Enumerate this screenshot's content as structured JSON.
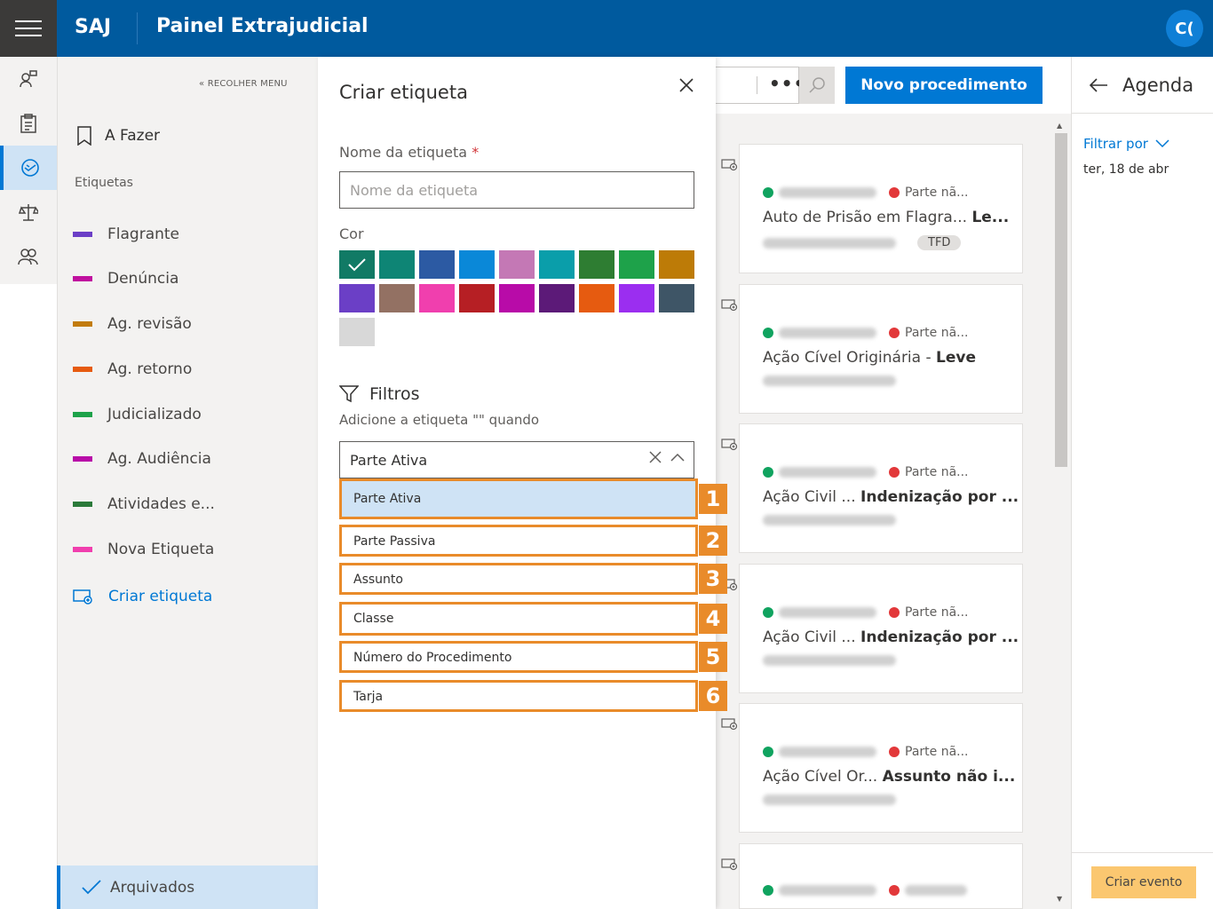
{
  "app": {
    "brand": "SAJ",
    "title": "Painel Extrajudicial",
    "avatar": "C("
  },
  "sidebar": {
    "collapse_label": "RECOLHER MENU",
    "afazer": "A Fazer",
    "etiquetas_heading": "Etiquetas",
    "tags": [
      {
        "label": "Flagrante",
        "color": "#6b3fc6"
      },
      {
        "label": "Denúncia",
        "color": "#c0109f"
      },
      {
        "label": "Ag. revisão",
        "color": "#c27c0e"
      },
      {
        "label": "Ag. retorno",
        "color": "#e65b10"
      },
      {
        "label": "Judicializado",
        "color": "#1ea24a"
      },
      {
        "label": "Ag. Audiência",
        "color": "#b80ba8"
      },
      {
        "label": "Atividades e...",
        "color": "#2b7a3a"
      },
      {
        "label": "Nova Etiqueta",
        "color": "#f03fae"
      }
    ],
    "criar_etiqueta": "Criar etiqueta",
    "arquivados": "Arquivados"
  },
  "panel": {
    "title": "Criar etiqueta",
    "name_label": "Nome da etiqueta",
    "required_mark": "*",
    "name_placeholder": "Nome da etiqueta",
    "color_label": "Cor",
    "colors": [
      "#117a65",
      "#0e8575",
      "#2c5aa3",
      "#0a88d8",
      "#c478b5",
      "#0a9eaa",
      "#2e7d32",
      "#1ea24a",
      "#bd7b07",
      "#6b3fc6",
      "#937163",
      "#f03fae",
      "#b61f24",
      "#b80ba8",
      "#5c1a78",
      "#e65b10",
      "#9b2ef0",
      "#3e5566",
      "#d8d8d8"
    ],
    "selected_color_index": 0,
    "filters_title": "Filtros",
    "filters_sub": "Adicione a etiqueta \"\" quando",
    "combo_value": "Parte Ativa",
    "options": [
      {
        "label": "Parte Ativa",
        "badge": "1"
      },
      {
        "label": "Parte Passiva",
        "badge": "2"
      },
      {
        "label": "Assunto",
        "badge": "3"
      },
      {
        "label": "Classe",
        "badge": "4"
      },
      {
        "label": "Número do Procedimento",
        "badge": "5"
      },
      {
        "label": "Tarja",
        "badge": "6"
      }
    ]
  },
  "toolbar": {
    "more": "•••",
    "new_button": "Novo procedimento"
  },
  "cards": [
    {
      "part_b": "Parte nã...",
      "title_a": "Auto de Prisão em Flagra...",
      "title_b": "Le...",
      "tag": "TFD"
    },
    {
      "part_b": "Parte nã...",
      "title_a": "Ação Cível Originária -",
      "title_b": "Leve",
      "tag": ""
    },
    {
      "part_b": "Parte nã...",
      "title_a": "Ação Civil ...",
      "title_b": "Indenização por ...",
      "tag": ""
    },
    {
      "part_b": "Parte nã...",
      "title_a": "Ação Civil ...",
      "title_b": "Indenização por ...",
      "tag": ""
    },
    {
      "part_b": "Parte nã...",
      "title_a": "Ação Cível Or...",
      "title_b": "Assunto não i...",
      "tag": ""
    },
    {
      "part_b": "",
      "title_a": "",
      "title_b": "",
      "tag": ""
    }
  ],
  "agenda": {
    "title": "Agenda",
    "filter": "Filtrar por",
    "date": "ter, 18 de abr",
    "create_event": "Criar evento"
  }
}
